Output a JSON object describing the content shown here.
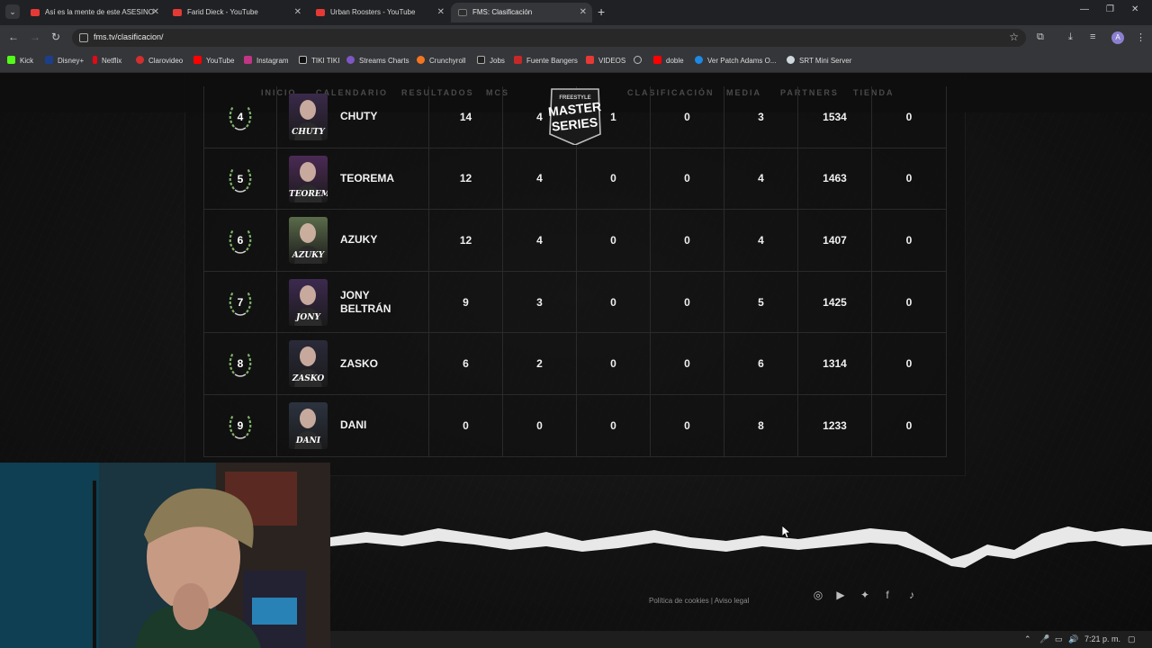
{
  "browser": {
    "tabs": [
      {
        "label": "Así es la mente de este ASESINO"
      },
      {
        "label": "Farid Dieck - YouTube"
      },
      {
        "label": "Urban Roosters - YouTube"
      },
      {
        "label": "FMS: Clasificación"
      }
    ],
    "url": "fms.tv/clasificacion/",
    "profile_initial": "A",
    "bookmarks": [
      "Kick",
      "Disney+",
      "Netflix",
      "Clarovideo",
      "YouTube",
      "Instagram",
      "TIKI TIKI",
      "Streams Charts",
      "Crunchyroll",
      "Jobs",
      "Fuente Bangers",
      "VIDEOS",
      "",
      "doble",
      "Ver Patch Adams O...",
      "SRT Mini Server"
    ]
  },
  "site": {
    "nav_left": [
      "INICIO",
      "CALENDARIO",
      "RESULTADOS",
      "MCS"
    ],
    "nav_right": [
      "CLASIFICACIÓN",
      "MEDIA",
      "PARTNERS",
      "TIENDA"
    ],
    "logo": {
      "top": "FREESTYLE",
      "main1": "MASTER",
      "main2": "SERIES"
    }
  },
  "standings": [
    {
      "pos": "4",
      "tag": "CHUTY",
      "name": "CHUTY",
      "stats": [
        "14",
        "4",
        "1",
        "0",
        "3",
        "1534",
        "0"
      ]
    },
    {
      "pos": "5",
      "tag": "TEOREMA",
      "name": "TEOREMA",
      "stats": [
        "12",
        "4",
        "0",
        "0",
        "4",
        "1463",
        "0"
      ]
    },
    {
      "pos": "6",
      "tag": "AZUKY",
      "name": "AZUKY",
      "stats": [
        "12",
        "4",
        "0",
        "0",
        "4",
        "1407",
        "0"
      ]
    },
    {
      "pos": "7",
      "tag": "JONY",
      "name": "JONY BELTRÁN",
      "stats": [
        "9",
        "3",
        "0",
        "0",
        "5",
        "1425",
        "0"
      ]
    },
    {
      "pos": "8",
      "tag": "ZASKO",
      "name": "ZASKO",
      "stats": [
        "6",
        "2",
        "0",
        "0",
        "6",
        "1314",
        "0"
      ]
    },
    {
      "pos": "9",
      "tag": "DANI",
      "name": "DANI",
      "stats": [
        "0",
        "0",
        "0",
        "0",
        "8",
        "1233",
        "0"
      ]
    }
  ],
  "footer": {
    "links": "Política de cookies | Aviso legal",
    "social": [
      "instagram-icon",
      "youtube-icon",
      "twitter-icon",
      "facebook-icon",
      "tiktok-icon"
    ]
  },
  "taskbar": {
    "time": "7:21 p. m."
  },
  "colors": {
    "laurel": "#7fb36a",
    "page_bg": "#121212",
    "nav_text": "#4a4a4a"
  }
}
